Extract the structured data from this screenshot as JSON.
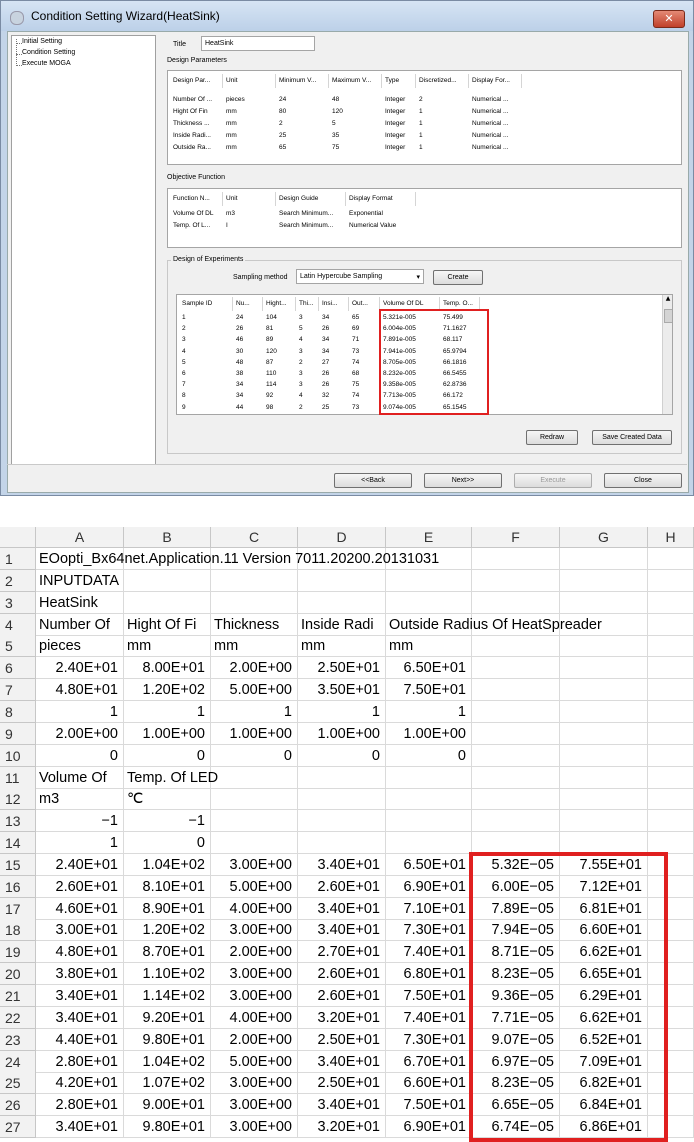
{
  "dialog": {
    "title": "Condition Setting Wizard(HeatSink)",
    "close_glyph": "✕",
    "tree": [
      "Initial Setting",
      "Condition Setting",
      "Execute MOGA"
    ],
    "title_label": "Title",
    "title_value": "HeatSink",
    "design_params": {
      "label": "Design Parameters",
      "headers": [
        "Design Par...",
        "Unit",
        "Minimum V...",
        "Maximum V...",
        "Type",
        "Discretized...",
        "Display For..."
      ],
      "rows": [
        [
          "Number Of ...",
          "pieces",
          "24",
          "48",
          "Integer",
          "2",
          "Numerical ..."
        ],
        [
          "Hight Of Fin",
          "mm",
          "80",
          "120",
          "Integer",
          "1",
          "Numerical ..."
        ],
        [
          "Thickness ...",
          "mm",
          "2",
          "5",
          "Integer",
          "1",
          "Numerical ..."
        ],
        [
          "Inside Radi...",
          "mm",
          "25",
          "35",
          "Integer",
          "1",
          "Numerical ..."
        ],
        [
          "Outside Ra...",
          "mm",
          "65",
          "75",
          "Integer",
          "1",
          "Numerical ..."
        ]
      ]
    },
    "objective": {
      "label": "Objective Function",
      "headers": [
        "Function N...",
        "Unit",
        "Design Guide",
        "Display Format"
      ],
      "rows": [
        [
          "Volume Of DL",
          "m3",
          "Search Minimum...",
          "Exponential"
        ],
        [
          "Temp. Of L...",
          "I",
          "Search Minimum...",
          "Numerical Value"
        ]
      ]
    },
    "doe": {
      "label": "Design of Experiments",
      "sampling_label": "Sampling method",
      "sampling_value": "Latin Hypercube Sampling",
      "create_label": "Create",
      "headers": [
        "Sample ID",
        "Nu...",
        "Hight...",
        "Thi...",
        "Insi...",
        "Out...",
        "Volume Of DL",
        "Temp. O..."
      ],
      "rows": [
        [
          "1",
          "24",
          "104",
          "3",
          "34",
          "65",
          "5.321e-005",
          "75.499"
        ],
        [
          "2",
          "26",
          "81",
          "5",
          "26",
          "69",
          "6.004e-005",
          "71.1627"
        ],
        [
          "3",
          "46",
          "89",
          "4",
          "34",
          "71",
          "7.891e-005",
          "68.117"
        ],
        [
          "4",
          "30",
          "120",
          "3",
          "34",
          "73",
          "7.941e-005",
          "65.9794"
        ],
        [
          "5",
          "48",
          "87",
          "2",
          "27",
          "74",
          "8.705e-005",
          "66.1816"
        ],
        [
          "6",
          "38",
          "110",
          "3",
          "26",
          "68",
          "8.232e-005",
          "66.5455"
        ],
        [
          "7",
          "34",
          "114",
          "3",
          "26",
          "75",
          "9.358e-005",
          "62.8736"
        ],
        [
          "8",
          "34",
          "92",
          "4",
          "32",
          "74",
          "7.713e-005",
          "66.172"
        ],
        [
          "9",
          "44",
          "98",
          "2",
          "25",
          "73",
          "9.074e-005",
          "65.1545"
        ]
      ],
      "redraw_label": "Redraw",
      "save_label": "Save Created Data"
    },
    "buttons": {
      "back": "<<Back",
      "next": "Next>>",
      "execute": "Execute",
      "close": "Close"
    }
  },
  "sheet": {
    "columns": [
      "A",
      "B",
      "C",
      "D",
      "E",
      "F",
      "G",
      "H"
    ],
    "rows": [
      {
        "n": "1",
        "cells": [
          {
            "c": "A",
            "v": "EOopti_Bx64net.Application.11  Version   7011.20200.20131031",
            "a": "l"
          }
        ]
      },
      {
        "n": "2",
        "cells": [
          {
            "c": "A",
            "v": "INPUTDATA",
            "a": "l"
          }
        ]
      },
      {
        "n": "3",
        "cells": [
          {
            "c": "A",
            "v": "HeatSink",
            "a": "l"
          }
        ]
      },
      {
        "n": "4",
        "cells": [
          {
            "c": "A",
            "v": "Number Of",
            "a": "l"
          },
          {
            "c": "B",
            "v": "Hight Of Fi",
            "a": "l"
          },
          {
            "c": "C",
            "v": "Thickness",
            "a": "l"
          },
          {
            "c": "D",
            "v": "Inside Radi",
            "a": "l"
          },
          {
            "c": "E",
            "v": "Outside Radius Of HeatSpreader",
            "a": "l"
          }
        ]
      },
      {
        "n": "5",
        "cells": [
          {
            "c": "A",
            "v": "pieces",
            "a": "l"
          },
          {
            "c": "B",
            "v": "mm",
            "a": "l"
          },
          {
            "c": "C",
            "v": "mm",
            "a": "l"
          },
          {
            "c": "D",
            "v": "mm",
            "a": "l"
          },
          {
            "c": "E",
            "v": "mm",
            "a": "l"
          }
        ]
      },
      {
        "n": "6",
        "cells": [
          {
            "c": "A",
            "v": "2.40E+01",
            "a": "r"
          },
          {
            "c": "B",
            "v": "8.00E+01",
            "a": "r"
          },
          {
            "c": "C",
            "v": "2.00E+00",
            "a": "r"
          },
          {
            "c": "D",
            "v": "2.50E+01",
            "a": "r"
          },
          {
            "c": "E",
            "v": "6.50E+01",
            "a": "r"
          }
        ]
      },
      {
        "n": "7",
        "cells": [
          {
            "c": "A",
            "v": "4.80E+01",
            "a": "r"
          },
          {
            "c": "B",
            "v": "1.20E+02",
            "a": "r"
          },
          {
            "c": "C",
            "v": "5.00E+00",
            "a": "r"
          },
          {
            "c": "D",
            "v": "3.50E+01",
            "a": "r"
          },
          {
            "c": "E",
            "v": "7.50E+01",
            "a": "r"
          }
        ]
      },
      {
        "n": "8",
        "cells": [
          {
            "c": "A",
            "v": "1",
            "a": "r"
          },
          {
            "c": "B",
            "v": "1",
            "a": "r"
          },
          {
            "c": "C",
            "v": "1",
            "a": "r"
          },
          {
            "c": "D",
            "v": "1",
            "a": "r"
          },
          {
            "c": "E",
            "v": "1",
            "a": "r"
          }
        ]
      },
      {
        "n": "9",
        "cells": [
          {
            "c": "A",
            "v": "2.00E+00",
            "a": "r"
          },
          {
            "c": "B",
            "v": "1.00E+00",
            "a": "r"
          },
          {
            "c": "C",
            "v": "1.00E+00",
            "a": "r"
          },
          {
            "c": "D",
            "v": "1.00E+00",
            "a": "r"
          },
          {
            "c": "E",
            "v": "1.00E+00",
            "a": "r"
          }
        ]
      },
      {
        "n": "10",
        "cells": [
          {
            "c": "A",
            "v": "0",
            "a": "r"
          },
          {
            "c": "B",
            "v": "0",
            "a": "r"
          },
          {
            "c": "C",
            "v": "0",
            "a": "r"
          },
          {
            "c": "D",
            "v": "0",
            "a": "r"
          },
          {
            "c": "E",
            "v": "0",
            "a": "r"
          }
        ]
      },
      {
        "n": "11",
        "cells": [
          {
            "c": "A",
            "v": "Volume Of",
            "a": "l"
          },
          {
            "c": "B",
            "v": "Temp. Of LED",
            "a": "l"
          }
        ]
      },
      {
        "n": "12",
        "cells": [
          {
            "c": "A",
            "v": "m3",
            "a": "l"
          },
          {
            "c": "B",
            "v": "℃",
            "a": "l"
          }
        ]
      },
      {
        "n": "13",
        "cells": [
          {
            "c": "A",
            "v": "−1",
            "a": "r"
          },
          {
            "c": "B",
            "v": "−1",
            "a": "r"
          }
        ]
      },
      {
        "n": "14",
        "cells": [
          {
            "c": "A",
            "v": "1",
            "a": "r"
          },
          {
            "c": "B",
            "v": "0",
            "a": "r"
          }
        ]
      },
      {
        "n": "15",
        "cells": [
          {
            "c": "A",
            "v": "2.40E+01",
            "a": "r"
          },
          {
            "c": "B",
            "v": "1.04E+02",
            "a": "r"
          },
          {
            "c": "C",
            "v": "3.00E+00",
            "a": "r"
          },
          {
            "c": "D",
            "v": "3.40E+01",
            "a": "r"
          },
          {
            "c": "E",
            "v": "6.50E+01",
            "a": "r"
          },
          {
            "c": "F",
            "v": "5.32E−05",
            "a": "r"
          },
          {
            "c": "G",
            "v": "7.55E+01",
            "a": "r"
          }
        ]
      },
      {
        "n": "16",
        "cells": [
          {
            "c": "A",
            "v": "2.60E+01",
            "a": "r"
          },
          {
            "c": "B",
            "v": "8.10E+01",
            "a": "r"
          },
          {
            "c": "C",
            "v": "5.00E+00",
            "a": "r"
          },
          {
            "c": "D",
            "v": "2.60E+01",
            "a": "r"
          },
          {
            "c": "E",
            "v": "6.90E+01",
            "a": "r"
          },
          {
            "c": "F",
            "v": "6.00E−05",
            "a": "r"
          },
          {
            "c": "G",
            "v": "7.12E+01",
            "a": "r"
          }
        ]
      },
      {
        "n": "17",
        "cells": [
          {
            "c": "A",
            "v": "4.60E+01",
            "a": "r"
          },
          {
            "c": "B",
            "v": "8.90E+01",
            "a": "r"
          },
          {
            "c": "C",
            "v": "4.00E+00",
            "a": "r"
          },
          {
            "c": "D",
            "v": "3.40E+01",
            "a": "r"
          },
          {
            "c": "E",
            "v": "7.10E+01",
            "a": "r"
          },
          {
            "c": "F",
            "v": "7.89E−05",
            "a": "r"
          },
          {
            "c": "G",
            "v": "6.81E+01",
            "a": "r"
          }
        ]
      },
      {
        "n": "18",
        "cells": [
          {
            "c": "A",
            "v": "3.00E+01",
            "a": "r"
          },
          {
            "c": "B",
            "v": "1.20E+02",
            "a": "r"
          },
          {
            "c": "C",
            "v": "3.00E+00",
            "a": "r"
          },
          {
            "c": "D",
            "v": "3.40E+01",
            "a": "r"
          },
          {
            "c": "E",
            "v": "7.30E+01",
            "a": "r"
          },
          {
            "c": "F",
            "v": "7.94E−05",
            "a": "r"
          },
          {
            "c": "G",
            "v": "6.60E+01",
            "a": "r"
          }
        ]
      },
      {
        "n": "19",
        "cells": [
          {
            "c": "A",
            "v": "4.80E+01",
            "a": "r"
          },
          {
            "c": "B",
            "v": "8.70E+01",
            "a": "r"
          },
          {
            "c": "C",
            "v": "2.00E+00",
            "a": "r"
          },
          {
            "c": "D",
            "v": "2.70E+01",
            "a": "r"
          },
          {
            "c": "E",
            "v": "7.40E+01",
            "a": "r"
          },
          {
            "c": "F",
            "v": "8.71E−05",
            "a": "r"
          },
          {
            "c": "G",
            "v": "6.62E+01",
            "a": "r"
          }
        ]
      },
      {
        "n": "20",
        "cells": [
          {
            "c": "A",
            "v": "3.80E+01",
            "a": "r"
          },
          {
            "c": "B",
            "v": "1.10E+02",
            "a": "r"
          },
          {
            "c": "C",
            "v": "3.00E+00",
            "a": "r"
          },
          {
            "c": "D",
            "v": "2.60E+01",
            "a": "r"
          },
          {
            "c": "E",
            "v": "6.80E+01",
            "a": "r"
          },
          {
            "c": "F",
            "v": "8.23E−05",
            "a": "r"
          },
          {
            "c": "G",
            "v": "6.65E+01",
            "a": "r"
          }
        ]
      },
      {
        "n": "21",
        "cells": [
          {
            "c": "A",
            "v": "3.40E+01",
            "a": "r"
          },
          {
            "c": "B",
            "v": "1.14E+02",
            "a": "r"
          },
          {
            "c": "C",
            "v": "3.00E+00",
            "a": "r"
          },
          {
            "c": "D",
            "v": "2.60E+01",
            "a": "r"
          },
          {
            "c": "E",
            "v": "7.50E+01",
            "a": "r"
          },
          {
            "c": "F",
            "v": "9.36E−05",
            "a": "r"
          },
          {
            "c": "G",
            "v": "6.29E+01",
            "a": "r"
          }
        ]
      },
      {
        "n": "22",
        "cells": [
          {
            "c": "A",
            "v": "3.40E+01",
            "a": "r"
          },
          {
            "c": "B",
            "v": "9.20E+01",
            "a": "r"
          },
          {
            "c": "C",
            "v": "4.00E+00",
            "a": "r"
          },
          {
            "c": "D",
            "v": "3.20E+01",
            "a": "r"
          },
          {
            "c": "E",
            "v": "7.40E+01",
            "a": "r"
          },
          {
            "c": "F",
            "v": "7.71E−05",
            "a": "r"
          },
          {
            "c": "G",
            "v": "6.62E+01",
            "a": "r"
          }
        ]
      },
      {
        "n": "23",
        "cells": [
          {
            "c": "A",
            "v": "4.40E+01",
            "a": "r"
          },
          {
            "c": "B",
            "v": "9.80E+01",
            "a": "r"
          },
          {
            "c": "C",
            "v": "2.00E+00",
            "a": "r"
          },
          {
            "c": "D",
            "v": "2.50E+01",
            "a": "r"
          },
          {
            "c": "E",
            "v": "7.30E+01",
            "a": "r"
          },
          {
            "c": "F",
            "v": "9.07E−05",
            "a": "r"
          },
          {
            "c": "G",
            "v": "6.52E+01",
            "a": "r"
          }
        ]
      },
      {
        "n": "24",
        "cells": [
          {
            "c": "A",
            "v": "2.80E+01",
            "a": "r"
          },
          {
            "c": "B",
            "v": "1.04E+02",
            "a": "r"
          },
          {
            "c": "C",
            "v": "5.00E+00",
            "a": "r"
          },
          {
            "c": "D",
            "v": "3.40E+01",
            "a": "r"
          },
          {
            "c": "E",
            "v": "6.70E+01",
            "a": "r"
          },
          {
            "c": "F",
            "v": "6.97E−05",
            "a": "r"
          },
          {
            "c": "G",
            "v": "7.09E+01",
            "a": "r"
          }
        ]
      },
      {
        "n": "25",
        "cells": [
          {
            "c": "A",
            "v": "4.20E+01",
            "a": "r"
          },
          {
            "c": "B",
            "v": "1.07E+02",
            "a": "r"
          },
          {
            "c": "C",
            "v": "3.00E+00",
            "a": "r"
          },
          {
            "c": "D",
            "v": "2.50E+01",
            "a": "r"
          },
          {
            "c": "E",
            "v": "6.60E+01",
            "a": "r"
          },
          {
            "c": "F",
            "v": "8.23E−05",
            "a": "r"
          },
          {
            "c": "G",
            "v": "6.82E+01",
            "a": "r"
          }
        ]
      },
      {
        "n": "26",
        "cells": [
          {
            "c": "A",
            "v": "2.80E+01",
            "a": "r"
          },
          {
            "c": "B",
            "v": "9.00E+01",
            "a": "r"
          },
          {
            "c": "C",
            "v": "3.00E+00",
            "a": "r"
          },
          {
            "c": "D",
            "v": "3.40E+01",
            "a": "r"
          },
          {
            "c": "E",
            "v": "7.50E+01",
            "a": "r"
          },
          {
            "c": "F",
            "v": "6.65E−05",
            "a": "r"
          },
          {
            "c": "G",
            "v": "6.84E+01",
            "a": "r"
          }
        ]
      },
      {
        "n": "27",
        "cells": [
          {
            "c": "A",
            "v": "3.40E+01",
            "a": "r"
          },
          {
            "c": "B",
            "v": "9.80E+01",
            "a": "r"
          },
          {
            "c": "C",
            "v": "3.00E+00",
            "a": "r"
          },
          {
            "c": "D",
            "v": "3.20E+01",
            "a": "r"
          },
          {
            "c": "E",
            "v": "6.90E+01",
            "a": "r"
          },
          {
            "c": "F",
            "v": "6.74E−05",
            "a": "r"
          },
          {
            "c": "G",
            "v": "6.86E+01",
            "a": "r"
          }
        ]
      }
    ]
  }
}
